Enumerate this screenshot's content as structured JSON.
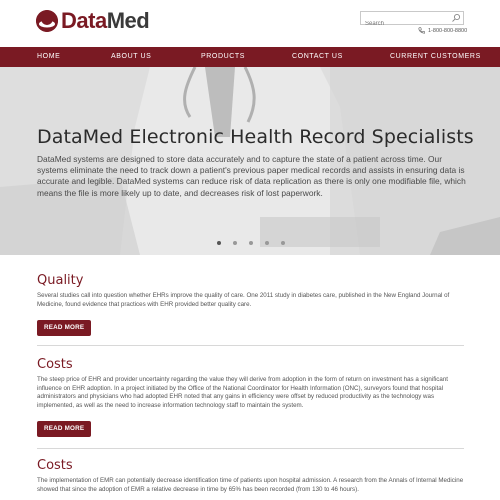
{
  "header": {
    "logo_part1": "Data",
    "logo_part2": "Med",
    "search_placeholder": "Search",
    "phone": "1-800-800-8800"
  },
  "nav": {
    "items": [
      "HOME",
      "ABOUT US",
      "PRODUCTS",
      "CONTACT US",
      "CURRENT CUSTOMERS"
    ]
  },
  "hero": {
    "title": "DataMed Electronic Health Record Specialists",
    "text": "DataMed systems are designed to store data accurately and to capture the state of a patient across time. Our systems eliminate the need to track down a patient's previous paper medical records and assists in ensuring data is accurate and legible. DataMed systems can reduce risk of data replication as there is only one modifiable file, which means the file is more likely up to date, and decreases risk of lost paperwork.",
    "slides": 5,
    "active_slide": 1
  },
  "sections": [
    {
      "title": "Quality",
      "text": "Several studies call into question whether EHRs improve the quality of care. One 2011 study in diabetes care, published in the New England Journal of Medicine, found evidence that practices with EHR provided better quality care.",
      "button": "READ MORE"
    },
    {
      "title": "Costs",
      "text": "The steep price of EHR and provider uncertainty regarding the value they will derive from adoption in the form of return on investment has a significant influence on EHR adoption. In a project initiated by the Office of the National Coordinator for Health Information (ONC), surveyors found that hospital administrators and physicians who had adopted EHR noted that any gains in efficiency were offset by reduced productivity as the technology was implemented, as well as the need to increase information technology staff to maintain the system.",
      "button": "READ MORE"
    },
    {
      "title": "Costs",
      "text": "The implementation of EMR can potentially decrease identification time of patients upon hospital admission. A research from the Annals of Internal Medicine showed that since the adoption of EMR a relative decrease in time by 65% has been recorded  (from 130 to 46 hours)."
    }
  ],
  "colors": {
    "brand": "#7a1a23",
    "text": "#555555"
  }
}
